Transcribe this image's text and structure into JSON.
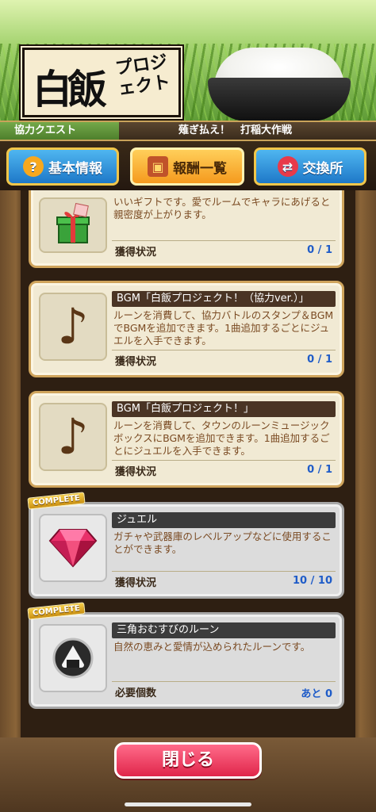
{
  "header": {
    "logo_kanji": "白飯",
    "logo_kana": "プロジェクト"
  },
  "quest": {
    "tag": "協力クエスト",
    "name": "薙ぎ払え！　打稲大作戦"
  },
  "tabs": [
    {
      "label": "基本情報",
      "icon": "question-icon",
      "active": false
    },
    {
      "label": "報酬一覧",
      "icon": "treasure-chest-icon",
      "active": true
    },
    {
      "label": "交換所",
      "icon": "exchange-icon",
      "active": false
    }
  ],
  "rewards": [
    {
      "title": "",
      "desc": "いいギフトです。愛でルームでキャラにあげると親密度が上がります。",
      "status_label": "獲得状況",
      "status_value": "0 / 1",
      "icon": "gift-box-icon",
      "complete": false
    },
    {
      "title": "BGM「白飯プロジェクト！（協力ver.）」",
      "desc": "ルーンを消費して、協力バトルのスタンプ＆BGMでBGMを追加できます。1曲追加するごとにジュエルを入手できます。",
      "status_label": "獲得状況",
      "status_value": "0 / 1",
      "icon": "music-note-icon",
      "complete": false
    },
    {
      "title": "BGM「白飯プロジェクト！」",
      "desc": "ルーンを消費して、タウンのルーンミュージックボックスにBGMを追加できます。1曲追加するごとにジュエルを入手できます。",
      "status_label": "獲得状況",
      "status_value": "0 / 1",
      "icon": "music-note-icon",
      "complete": false
    },
    {
      "title": "ジュエル",
      "desc": "ガチャや武器庫のレベルアップなどに使用することができます。",
      "status_label": "獲得状況",
      "status_value": "10 / 10",
      "icon": "jewel-icon",
      "complete": true,
      "badge": "COMPLETE"
    },
    {
      "title": "三角おむすびのルーン",
      "desc": "自然の恵みと愛情が込められたルーンです。",
      "status_label": "必要個数",
      "status_value": "あと 0",
      "icon": "onigiri-rune-icon",
      "complete": true,
      "badge": "COMPLETE"
    }
  ],
  "footer": {
    "close_label": "閉じる"
  }
}
